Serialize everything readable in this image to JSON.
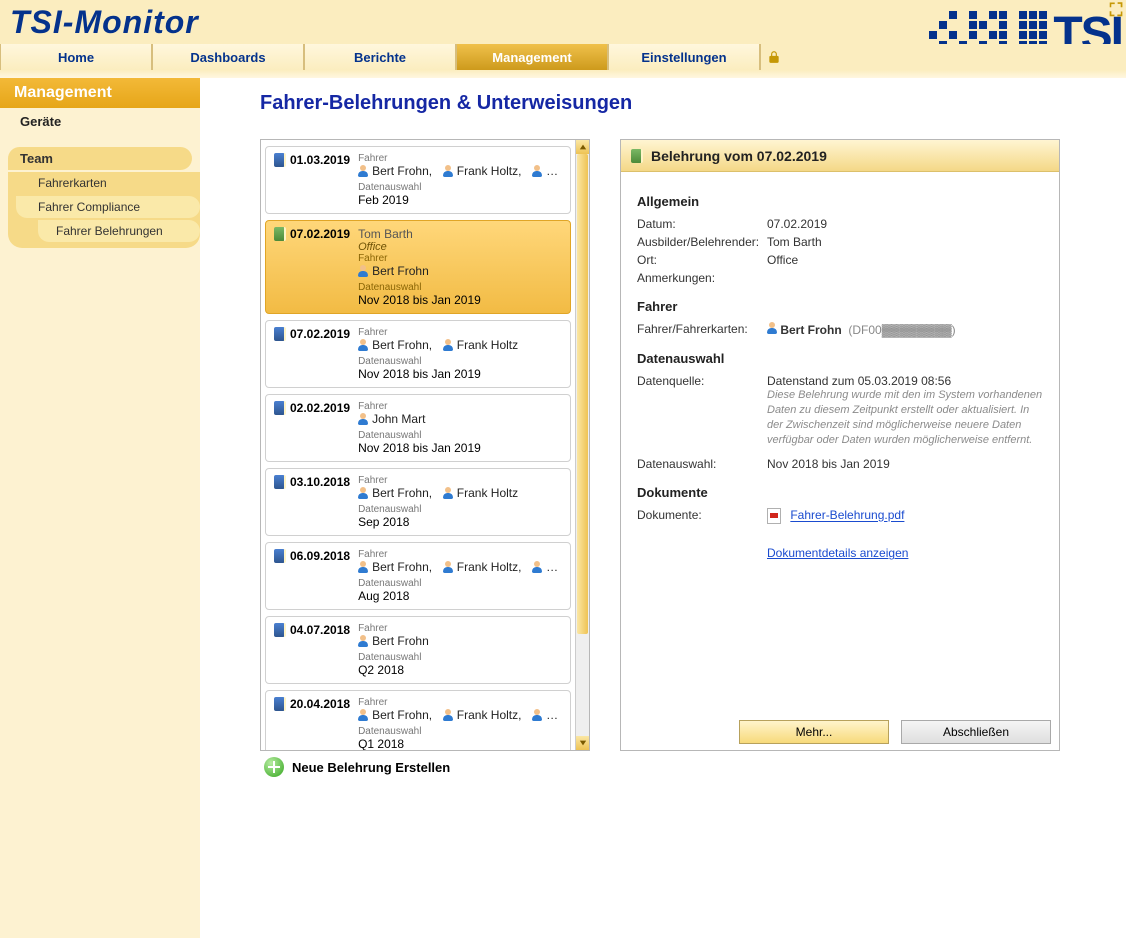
{
  "brand": "TSI-Monitor",
  "logo_text": "TSI",
  "nav": {
    "items": [
      "Home",
      "Dashboards",
      "Berichte",
      "Management",
      "Einstellungen"
    ],
    "active_index": 3
  },
  "sidebar": {
    "title": "Management",
    "geraete": "Geräte",
    "team": "Team",
    "items": [
      {
        "label": "Fahrerkarten",
        "active": false
      },
      {
        "label": "Fahrer Compliance",
        "active": true
      },
      {
        "label": "Fahrer Belehrungen",
        "active": true,
        "inner": true
      }
    ]
  },
  "pageTitle": "Fahrer-Belehrungen & Unterweisungen",
  "list": {
    "labels": {
      "fahrer": "Fahrer",
      "datenauswahl": "Datenauswahl"
    },
    "entries": [
      {
        "date": "01.03.2019",
        "drivers": [
          "Bert Frohn",
          "Frank Holtz"
        ],
        "more": true,
        "range": "Feb 2019",
        "selected": false
      },
      {
        "date": "07.02.2019",
        "trainer": "Tom Barth",
        "place": "Office",
        "drivers": [
          "Bert Frohn"
        ],
        "range": "Nov 2018 bis Jan 2019",
        "selected": true,
        "green": true
      },
      {
        "date": "07.02.2019",
        "drivers": [
          "Bert Frohn",
          "Frank Holtz"
        ],
        "range": "Nov 2018 bis Jan 2019",
        "selected": false
      },
      {
        "date": "02.02.2019",
        "drivers": [
          "John Mart"
        ],
        "range": "Nov 2018 bis Jan 2019",
        "selected": false
      },
      {
        "date": "03.10.2018",
        "drivers": [
          "Bert Frohn",
          "Frank Holtz"
        ],
        "range": "Sep 2018",
        "selected": false
      },
      {
        "date": "06.09.2018",
        "drivers": [
          "Bert Frohn",
          "Frank Holtz"
        ],
        "more": true,
        "range": "Aug 2018",
        "selected": false
      },
      {
        "date": "04.07.2018",
        "drivers": [
          "Bert Frohn"
        ],
        "range": "Q2 2018",
        "selected": false
      },
      {
        "date": "20.04.2018",
        "drivers": [
          "Bert Frohn",
          "Frank Holtz"
        ],
        "more": true,
        "range": "Q1 2018",
        "selected": false
      }
    ],
    "new_label": "Neue Belehrung Erstellen"
  },
  "detail": {
    "header": "Belehrung vom 07.02.2019",
    "sections": {
      "allgemein": {
        "title": "Allgemein",
        "rows": {
          "datum_k": "Datum:",
          "datum_v": "07.02.2019",
          "ausb_k": "Ausbilder/Belehrender:",
          "ausb_v": "Tom Barth",
          "ort_k": "Ort:",
          "ort_v": "Office",
          "anm_k": "Anmerkungen:",
          "anm_v": ""
        }
      },
      "fahrer": {
        "title": "Fahrer",
        "row_k": "Fahrer/Fahrerkarten:",
        "name": "Bert Frohn",
        "card": "(DF00▓▓▓▓▓▓▓▓)"
      },
      "daten": {
        "title": "Datenauswahl",
        "quelle_k": "Datenquelle:",
        "quelle_v": "Datenstand zum 05.03.2019 08:56",
        "note": "Diese Belehrung wurde mit den im System vorhandenen Daten zu diesem Zeitpunkt erstellt oder aktualisiert. In der Zwischenzeit sind möglicherweise neuere Daten verfügbar oder Daten wurden möglicherweise entfernt.",
        "auswahl_k": "Datenauswahl:",
        "auswahl_v": "Nov 2018 bis Jan 2019"
      },
      "dok": {
        "title": "Dokumente",
        "row_k": "Dokumente:",
        "file": "Fahrer-Belehrung.pdf",
        "details": "Dokumentdetails anzeigen"
      }
    },
    "buttons": {
      "mehr": "Mehr...",
      "abschliessen": "Abschließen"
    }
  }
}
